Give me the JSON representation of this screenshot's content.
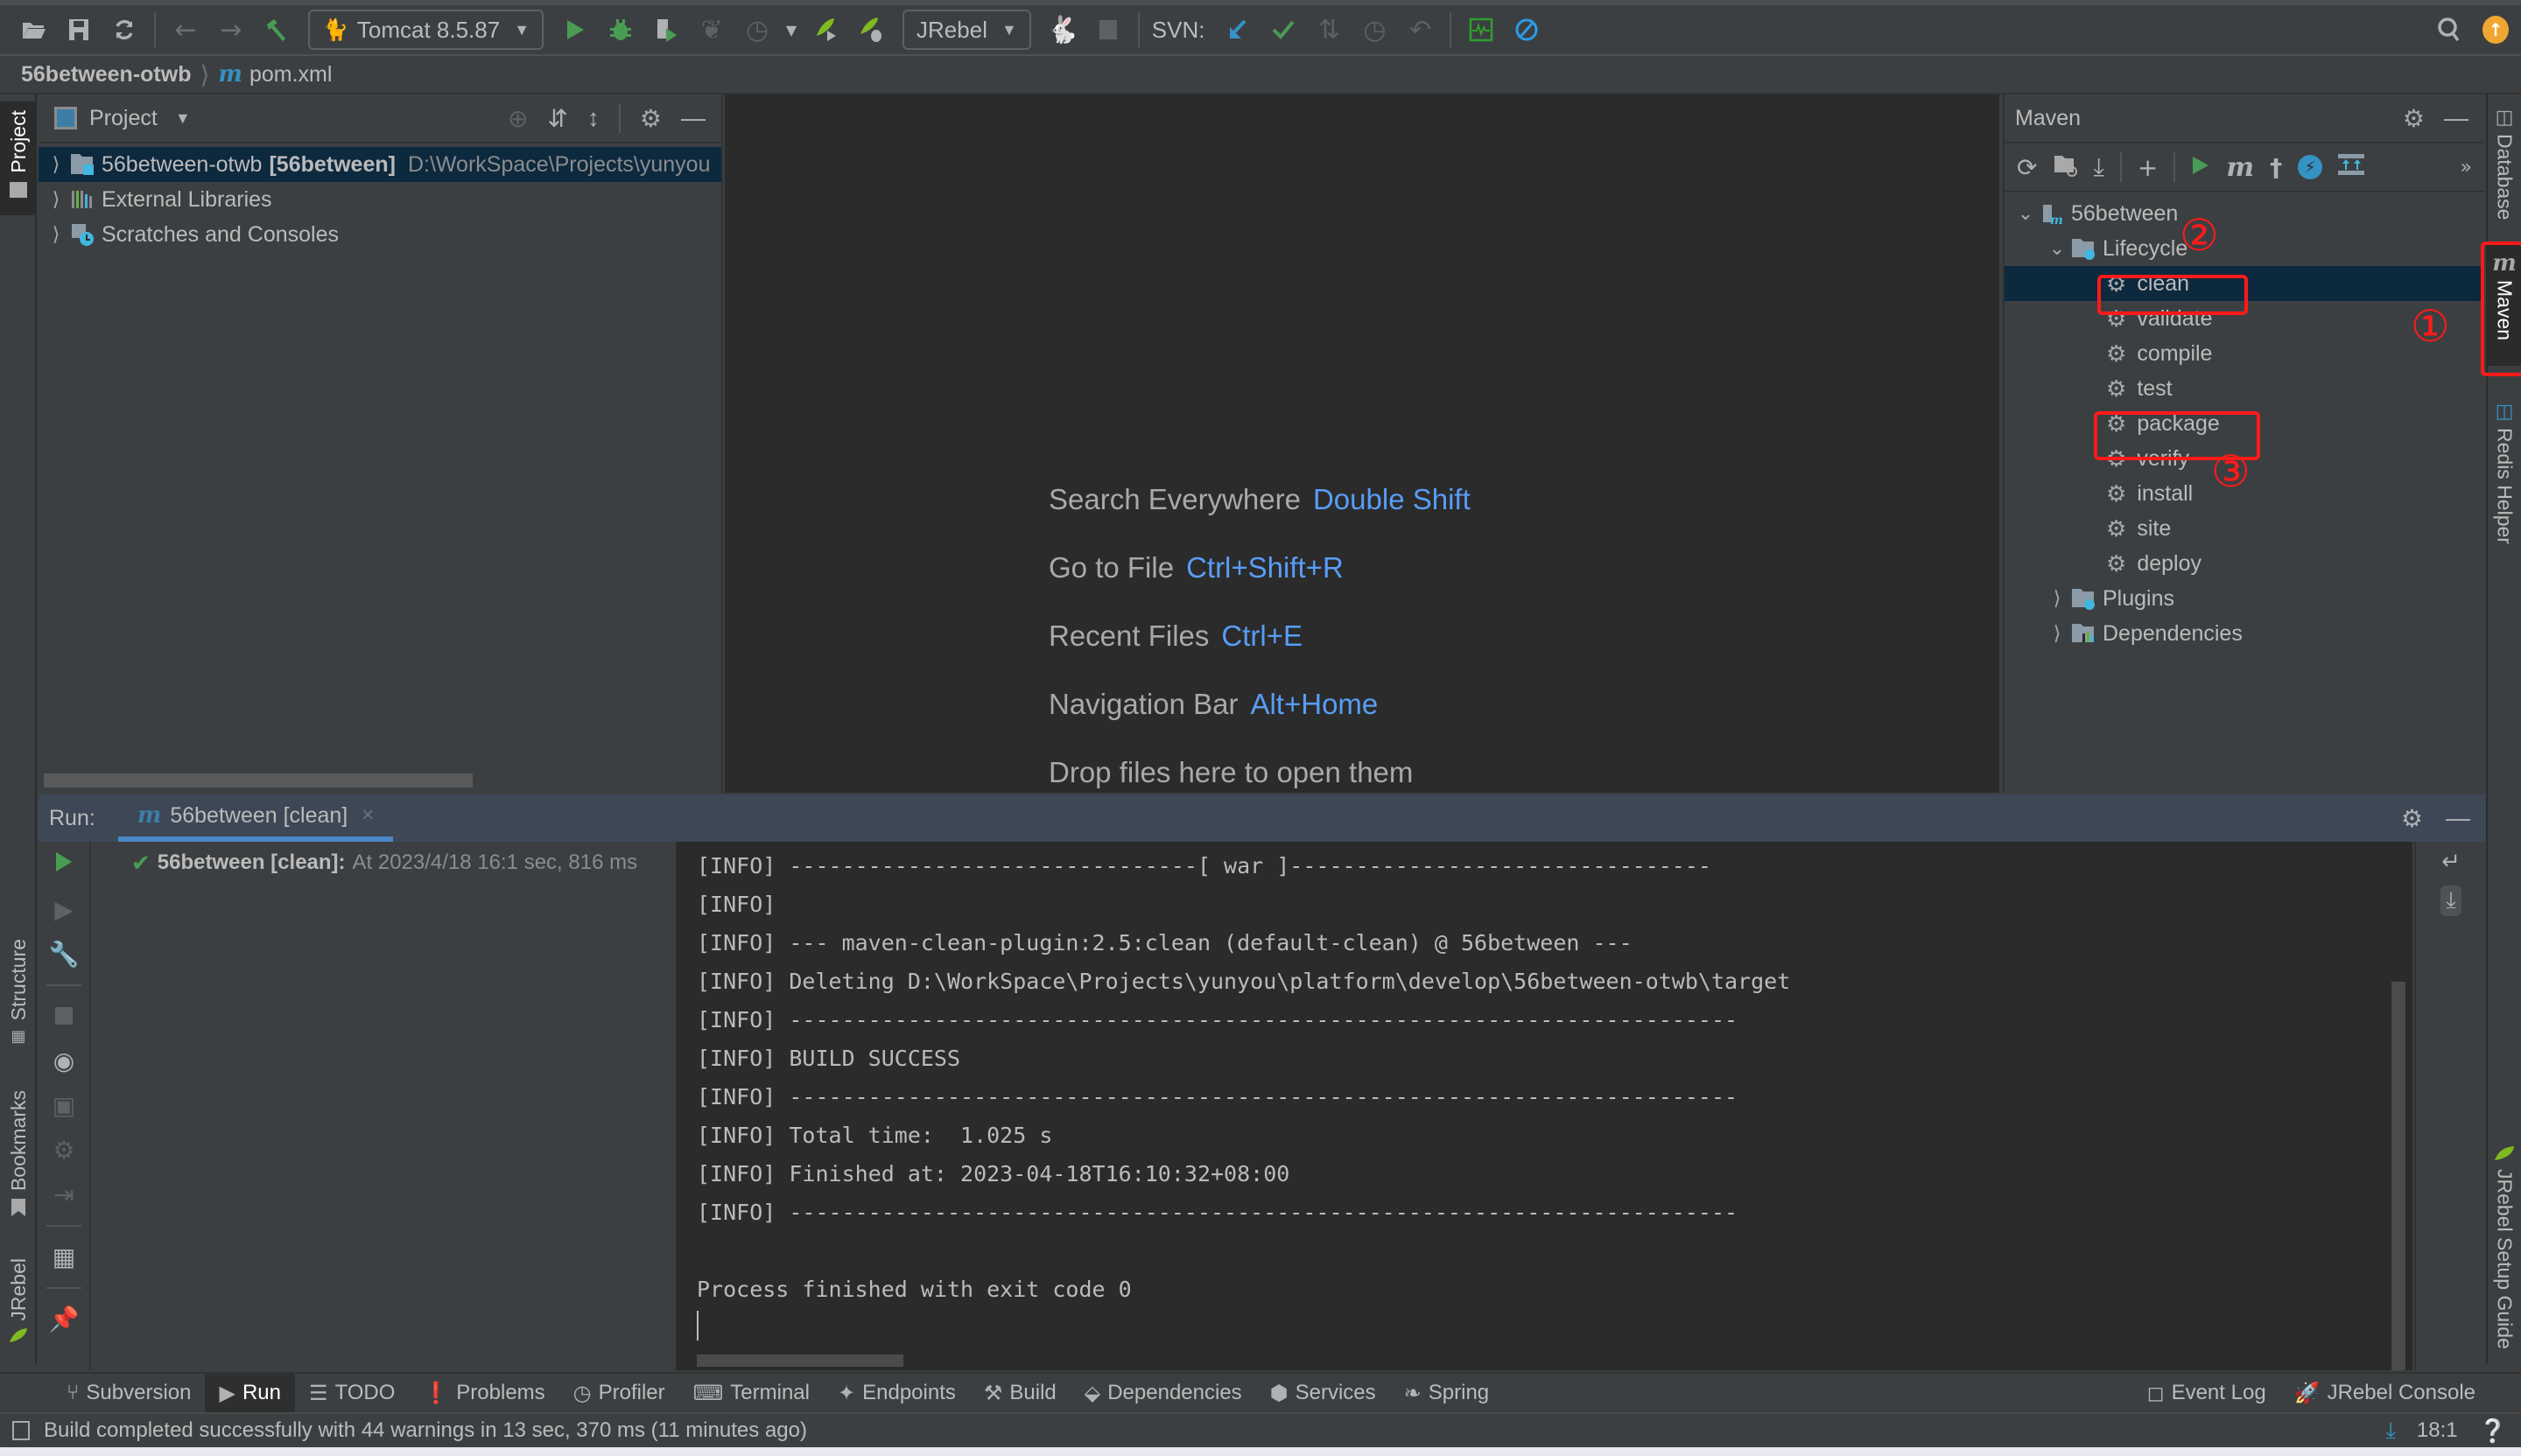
{
  "toolbar": {
    "run_config": "Tomcat 8.5.87",
    "jrebel_config": "JRebel",
    "svn_label": "SVN:"
  },
  "breadcrumb": {
    "project": "56between-otwb",
    "file": "pom.xml"
  },
  "left_stripe": {
    "project_tab": "Project",
    "structure_tab": "Structure",
    "bookmarks_tab": "Bookmarks",
    "jrebel_tab": "JRebel"
  },
  "right_stripe": {
    "database_tab": "Database",
    "maven_tab": "Maven",
    "redis_tab": "Redis Helper",
    "jrebel_guide_tab": "JRebel Setup Guide"
  },
  "project_panel": {
    "title": "Project",
    "tree": [
      {
        "name": "56between-otwb",
        "module": "[56between]",
        "path": "D:\\WorkSpace\\Projects\\yunyou"
      },
      {
        "name": "External Libraries"
      },
      {
        "name": "Scratches and Consoles"
      }
    ]
  },
  "editor": {
    "hints": [
      {
        "label": "Search Everywhere",
        "shortcut": "Double Shift"
      },
      {
        "label": "Go to File",
        "shortcut": "Ctrl+Shift+R"
      },
      {
        "label": "Recent Files",
        "shortcut": "Ctrl+E"
      },
      {
        "label": "Navigation Bar",
        "shortcut": "Alt+Home"
      },
      {
        "label": "Drop files here to open them",
        "shortcut": ""
      }
    ]
  },
  "maven_panel": {
    "title": "Maven",
    "root": "56between",
    "lifecycle_label": "Lifecycle",
    "lifecycle": [
      "clean",
      "validate",
      "compile",
      "test",
      "package",
      "verify",
      "install",
      "site",
      "deploy"
    ],
    "selected": "clean",
    "plugins_label": "Plugins",
    "dependencies_label": "Dependencies",
    "annotations": [
      "①",
      "②",
      "③"
    ]
  },
  "run_panel": {
    "label": "Run:",
    "tab_title": "56between [clean]",
    "tree_item_title": "56between [clean]:",
    "tree_item_detail": "At 2023/4/18 16:1 sec, 816 ms",
    "console_lines": [
      "[INFO] -------------------------------[ war ]--------------------------------",
      "[INFO]",
      "[INFO] --- maven-clean-plugin:2.5:clean (default-clean) @ 56between ---",
      "[INFO] Deleting D:\\WorkSpace\\Projects\\yunyou\\platform\\develop\\56between-otwb\\target",
      "[INFO] ------------------------------------------------------------------------",
      "[INFO] BUILD SUCCESS",
      "[INFO] ------------------------------------------------------------------------",
      "[INFO] Total time:  1.025 s",
      "[INFO] Finished at: 2023-04-18T16:10:32+08:00",
      "[INFO] ------------------------------------------------------------------------",
      "",
      "Process finished with exit code 0"
    ]
  },
  "bottom_tabs": [
    {
      "label": "Subversion",
      "icon": "subversion-icon"
    },
    {
      "label": "Run",
      "icon": "run-icon",
      "active": true
    },
    {
      "label": "TODO",
      "icon": "todo-icon"
    },
    {
      "label": "Problems",
      "icon": "problems-icon"
    },
    {
      "label": "Profiler",
      "icon": "profiler-icon"
    },
    {
      "label": "Terminal",
      "icon": "terminal-icon"
    },
    {
      "label": "Endpoints",
      "icon": "endpoints-icon"
    },
    {
      "label": "Build",
      "icon": "build-icon"
    },
    {
      "label": "Dependencies",
      "icon": "dependencies-icon"
    },
    {
      "label": "Services",
      "icon": "services-icon"
    },
    {
      "label": "Spring",
      "icon": "spring-icon"
    }
  ],
  "bottom_right_tabs": {
    "event_log": "Event Log",
    "jrebel_console": "JRebel Console"
  },
  "status_bar": {
    "message": "Build completed successfully with 44 warnings in 13 sec, 370 ms (11 minutes ago)",
    "position": "18:1"
  },
  "colors": {
    "accent_blue": "#589df6",
    "run_green": "#499c54",
    "selection": "#0d293e",
    "annotation_red": "#ff1a1a"
  }
}
